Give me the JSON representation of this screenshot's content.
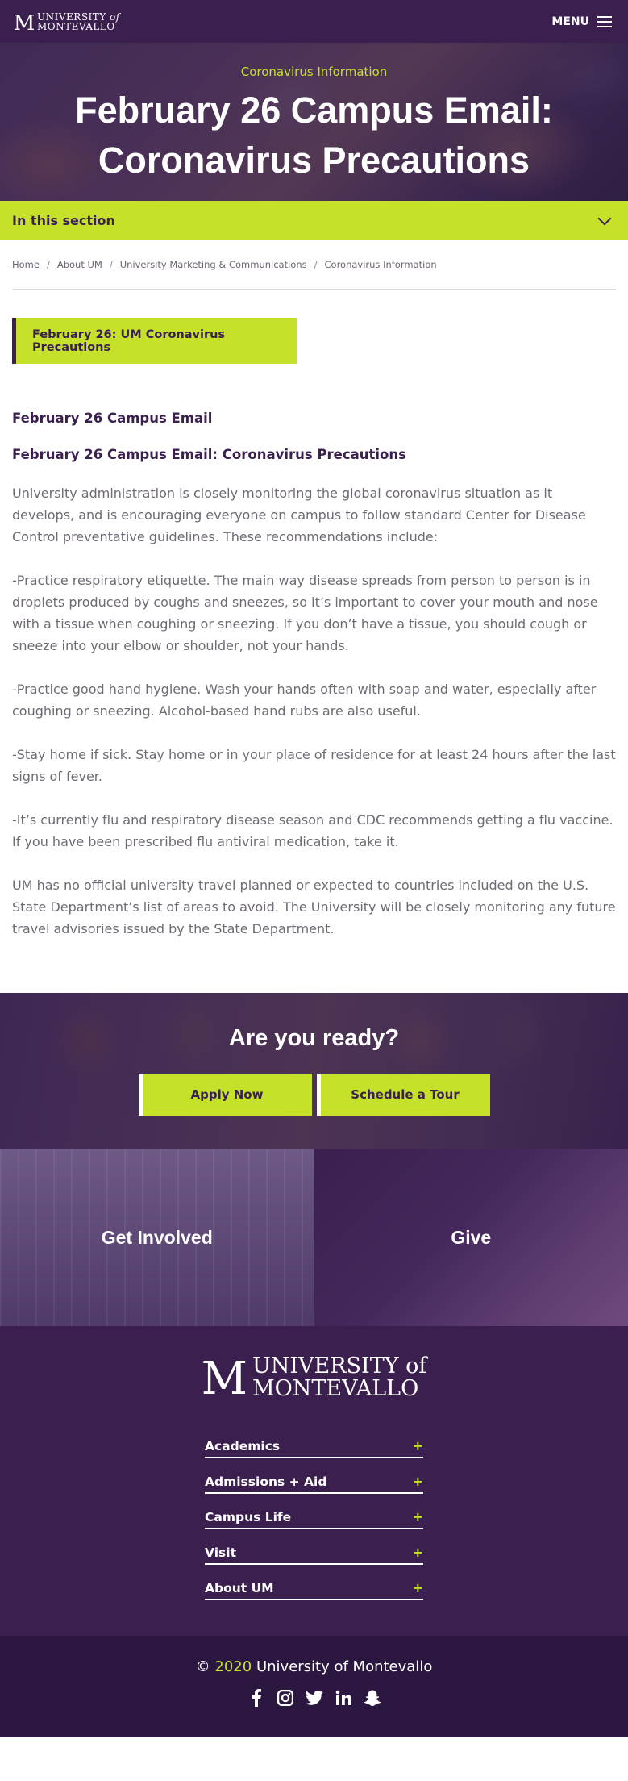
{
  "header": {
    "logo_text": "UNIVERSITY of MONTEVALLO",
    "menu_label": "MENU"
  },
  "hero": {
    "kicker": "Coronavirus Information",
    "title": "February 26 Campus Email: Coronavirus Precautions"
  },
  "section_nav": {
    "label": "In this section"
  },
  "breadcrumb": {
    "items": [
      "Home",
      "About UM",
      "University Marketing & Communications",
      "Coronavirus Information"
    ]
  },
  "callout": {
    "label": "February 26: UM Coronavirus Precautions"
  },
  "article": {
    "heading": "February 26 Campus Email",
    "subheading": "February 26 Campus Email: Coronavirus Precautions",
    "paragraphs": [
      "University administration is closely monitoring the global coronavirus situation as it develops, and is encouraging everyone on campus to follow standard Center for Disease Control preventative guidelines. These recommendations include:",
      "-Practice respiratory etiquette. The main way disease spreads from person to person is in droplets produced by coughs and sneezes, so it’s important to cover your mouth and nose with a tissue when coughing or sneezing. If you don’t have a tissue, you should cough or sneeze into your elbow or shoulder, not your hands.",
      "-Practice good hand hygiene. Wash your hands often with soap and water, especially after coughing or sneezing. Alcohol-based hand rubs are also useful.",
      "-Stay home if sick. Stay home or in your place of residence for at least 24 hours after the last signs of fever.",
      "-It’s currently flu and respiratory disease season and CDC recommends getting a flu vaccine. If you have been prescribed flu antiviral medication, take it.",
      "UM has no official university travel planned or expected to countries included on the U.S. State Department’s list of areas to avoid. The University will be closely monitoring any future travel advisories issued by the State Department."
    ]
  },
  "ready": {
    "title": "Are you ready?",
    "apply_label": "Apply Now",
    "tour_label": "Schedule a Tour"
  },
  "tiles": {
    "involved_label": "Get Involved",
    "give_label": "Give"
  },
  "footer": {
    "logo_line1": "UNIVERSITY of",
    "logo_line2": "MONTEVALLO",
    "links": [
      {
        "label": "Academics",
        "toggle": "+"
      },
      {
        "label": "Admissions + Aid",
        "toggle": "+"
      },
      {
        "label": "Campus Life",
        "toggle": "+"
      },
      {
        "label": "Visit",
        "toggle": "+"
      },
      {
        "label": "About UM",
        "toggle": "+"
      }
    ],
    "copyright_symbol": "©",
    "year": "2020",
    "org": "University of Montevallo",
    "socials": [
      "facebook-icon",
      "instagram-icon",
      "twitter-icon",
      "linkedin-icon",
      "snapchat-icon"
    ]
  },
  "colors": {
    "brand_purple": "#3a1f4f",
    "accent_lime": "#c5e12a"
  }
}
